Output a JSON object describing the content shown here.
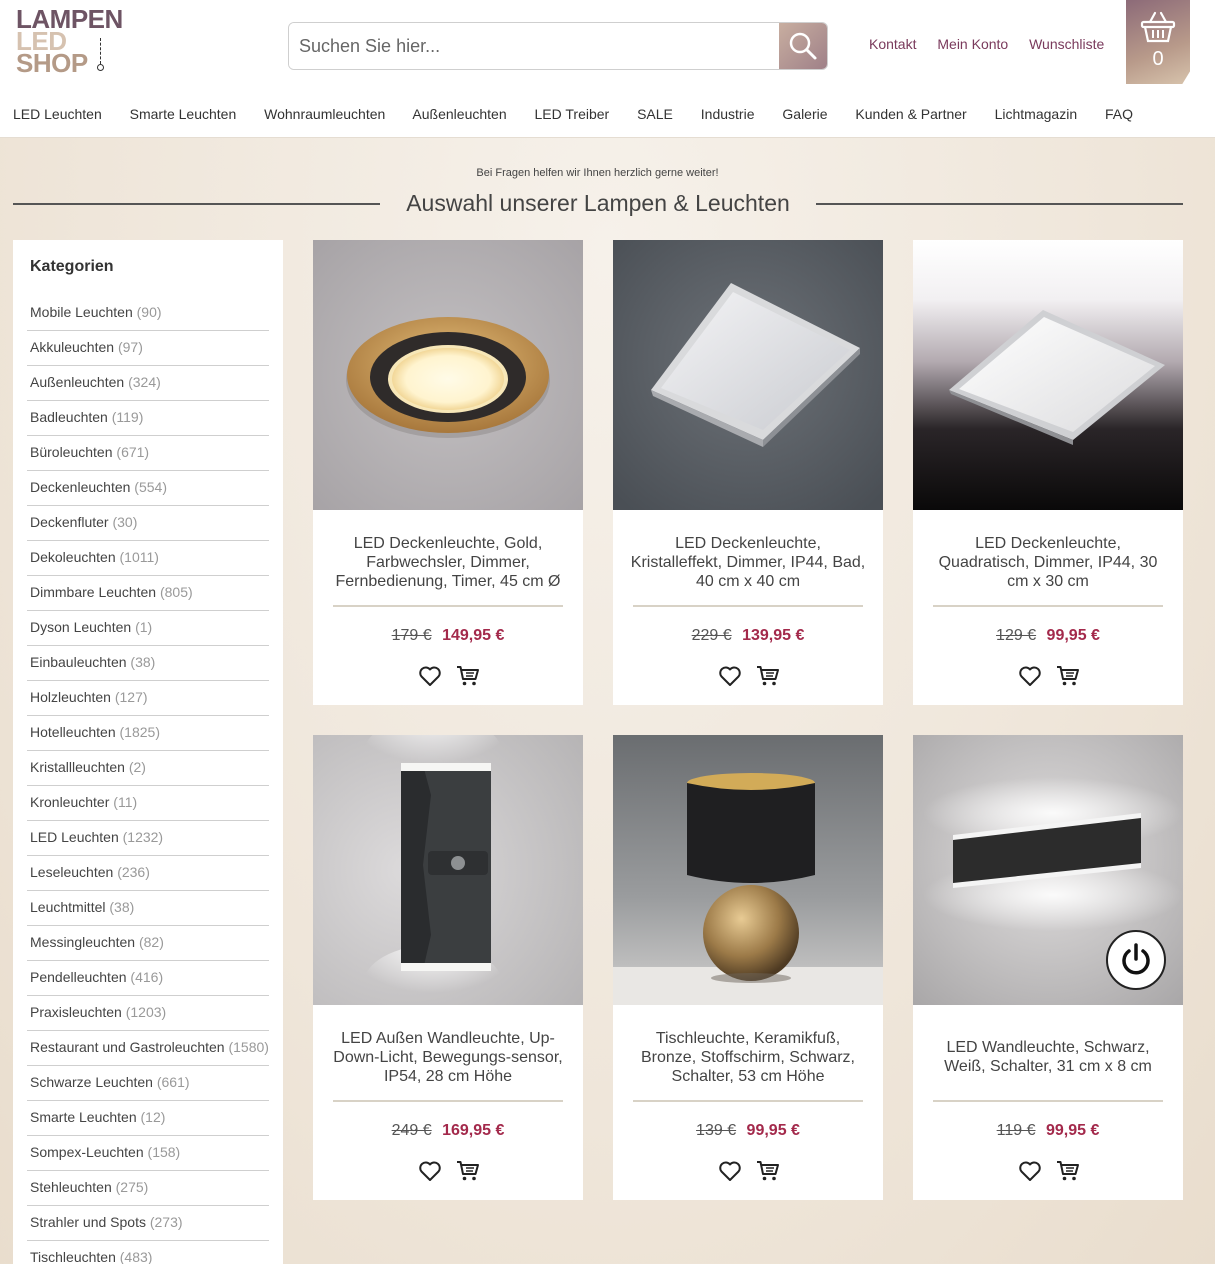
{
  "logo": {
    "line1": "LAMPEN",
    "line2": "LED",
    "line3": "SHOP"
  },
  "search": {
    "placeholder": "Suchen Sie hier..."
  },
  "toplinks": [
    "Kontakt",
    "Mein Konto",
    "Wunschliste"
  ],
  "cart": {
    "count": "0"
  },
  "nav": [
    "LED Leuchten",
    "Smarte Leuchten",
    "Wohnraumleuchten",
    "Außenleuchten",
    "LED Treiber",
    "SALE",
    "Industrie",
    "Galerie",
    "Kunden & Partner",
    "Lichtmagazin",
    "FAQ"
  ],
  "subtitle": "Bei Fragen helfen wir Ihnen herzlich gerne weiter!",
  "title": "Auswahl unserer Lampen & Leuchten",
  "sidebar": {
    "heading": "Kategorien",
    "items": [
      {
        "label": "Mobile Leuchten",
        "count": "(90)"
      },
      {
        "label": "Akkuleuchten",
        "count": "(97)"
      },
      {
        "label": "Außenleuchten",
        "count": "(324)"
      },
      {
        "label": "Badleuchten",
        "count": "(119)"
      },
      {
        "label": "Büroleuchten",
        "count": "(671)"
      },
      {
        "label": "Deckenleuchten",
        "count": "(554)"
      },
      {
        "label": "Deckenfluter",
        "count": "(30)"
      },
      {
        "label": "Dekoleuchten",
        "count": "(1011)"
      },
      {
        "label": "Dimmbare Leuchten",
        "count": "(805)"
      },
      {
        "label": "Dyson Leuchten",
        "count": "(1)"
      },
      {
        "label": "Einbauleuchten",
        "count": "(38)"
      },
      {
        "label": "Holzleuchten",
        "count": "(127)"
      },
      {
        "label": "Hotelleuchten",
        "count": "(1825)"
      },
      {
        "label": "Kristallleuchten",
        "count": "(2)"
      },
      {
        "label": "Kronleuchter",
        "count": "(11)"
      },
      {
        "label": "LED Leuchten",
        "count": "(1232)"
      },
      {
        "label": "Leseleuchten",
        "count": "(236)"
      },
      {
        "label": "Leuchtmittel",
        "count": "(38)"
      },
      {
        "label": "Messingleuchten",
        "count": "(82)"
      },
      {
        "label": "Pendelleuchten",
        "count": "(416)"
      },
      {
        "label": "Praxisleuchten",
        "count": "(1203)"
      },
      {
        "label": "Restaurant und Gastroleuchten",
        "count": "(1580)"
      },
      {
        "label": "Schwarze Leuchten",
        "count": "(661)"
      },
      {
        "label": "Smarte Leuchten",
        "count": "(12)"
      },
      {
        "label": "Sompex-Leuchten",
        "count": "(158)"
      },
      {
        "label": "Stehleuchten",
        "count": "(275)"
      },
      {
        "label": "Strahler und Spots",
        "count": "(273)"
      },
      {
        "label": "Tischleuchten",
        "count": "(483)"
      }
    ]
  },
  "products": [
    {
      "name": "LED Deckenleuchte, Gold, Farbwechsler, Dimmer, Fernbedienung, Timer, 45 cm Ø",
      "old_price": "179 €",
      "price": "149,95 €",
      "image": "round-gold-ceiling-light"
    },
    {
      "name": "LED Deckenleuchte, Kristalleffekt, Dimmer, IP44, Bad, 40 cm x 40 cm",
      "old_price": "229 €",
      "price": "139,95 €",
      "image": "square-crystal-ceiling-light"
    },
    {
      "name": "LED Deckenleuchte, Quadratisch, Dimmer, IP44, 30 cm x 30 cm",
      "old_price": "129 €",
      "price": "99,95 €",
      "image": "square-silver-ceiling-light"
    },
    {
      "name": "LED Außen Wandleuchte, Up-Down-Licht, Bewegungs-sensor, IP54, 28 cm Höhe",
      "old_price": "249 €",
      "price": "169,95 €",
      "image": "outdoor-wall-light"
    },
    {
      "name": "Tischleuchte, Keramikfuß, Bronze, Stoffschirm, Schwarz, Schalter, 53 cm Höhe",
      "old_price": "139 €",
      "price": "99,95 €",
      "image": "table-lamp-bronze"
    },
    {
      "name": "LED Wandleuchte, Schwarz, Weiß, Schalter, 31 cm x 8 cm",
      "old_price": "119 €",
      "price": "99,95 €",
      "image": "black-wall-light"
    }
  ],
  "colors": {
    "accent": "#a3294b",
    "link": "#7a3a5c"
  }
}
